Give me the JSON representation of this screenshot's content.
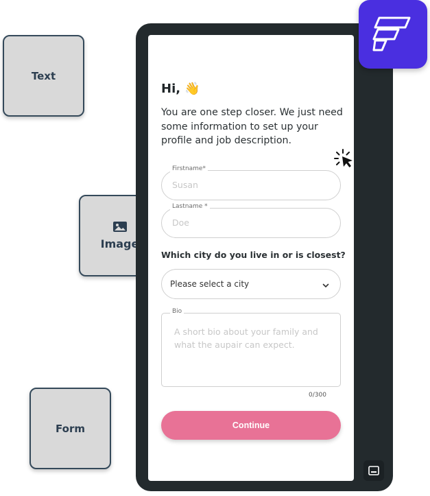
{
  "tiles": {
    "text": "Text",
    "image": "Image",
    "form": "Form"
  },
  "icons": {
    "brand": "brand-logo-icon",
    "image": "image-icon",
    "wave": "waving-hand-icon",
    "cursor": "click-cursor-icon",
    "chevron": "chevron-down-icon",
    "tray": "subtitles-icon"
  },
  "colors": {
    "brand": "#4a2fe0",
    "accent": "#e87296",
    "phone": "#232a2d"
  },
  "form": {
    "greeting": "Hi, 👋",
    "intro": "You are one step closer. We just need some information to set up your profile and job description.",
    "firstname": {
      "label": "Firstname*",
      "placeholder": "Susan"
    },
    "lastname": {
      "label": "Lastname *",
      "placeholder": "Doe"
    },
    "city_question": "Which city do you live in or is closest?",
    "city_select": "Please select a city",
    "bio": {
      "label": "Bio",
      "placeholder": "A short bio about your family and what the aupair can expect.",
      "counter": "0/300"
    },
    "continue_label": "Continue"
  }
}
